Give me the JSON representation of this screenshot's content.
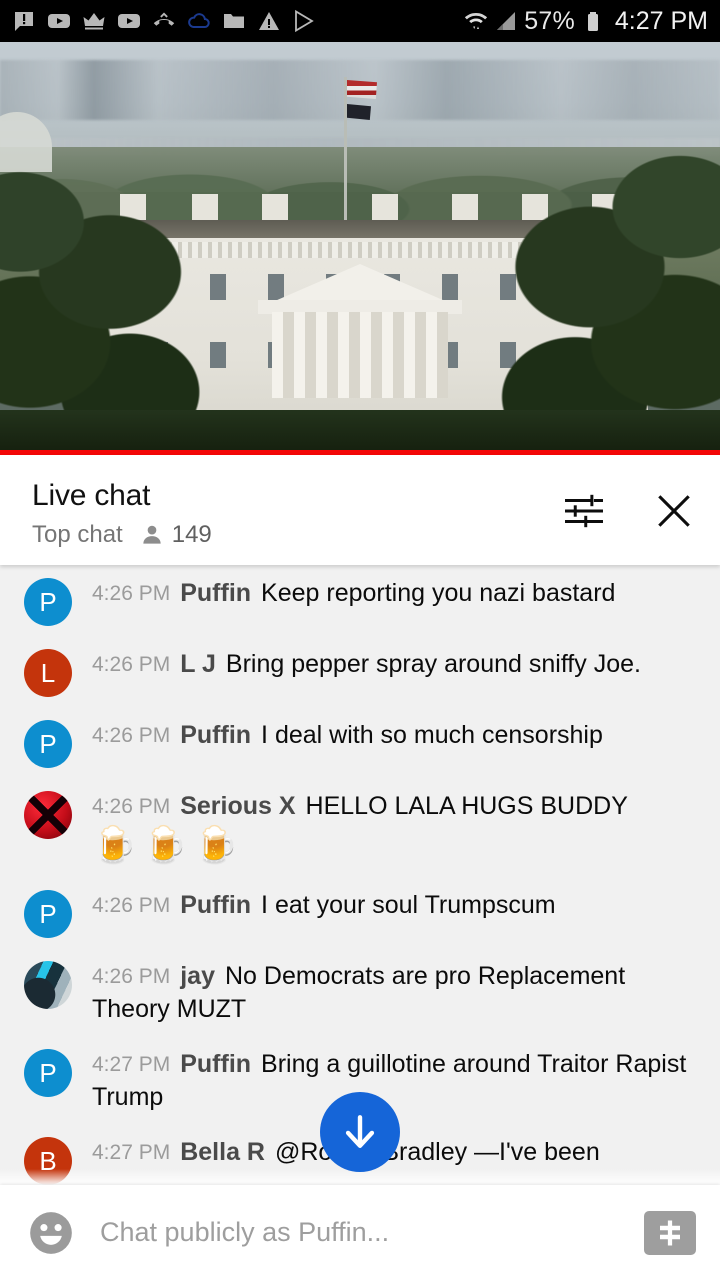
{
  "statusbar": {
    "icons": [
      "chat-alert-icon",
      "youtube-icon",
      "crown-icon",
      "youtube-icon",
      "missed-call-icon",
      "cloud-icon",
      "folder-icon",
      "warning-icon",
      "play-store-icon"
    ],
    "wifi_icon": "wifi-transfer-icon",
    "signal_icon": "cell-signal-icon",
    "battery_percent": "57%",
    "battery_icon": "battery-icon",
    "time": "4:27 PM"
  },
  "video": {
    "description": "White House live stream",
    "progress_percent": 100,
    "progress_color": "#f40707"
  },
  "chat_header": {
    "title": "Live chat",
    "subtitle": "Top chat",
    "viewer_icon": "person-icon",
    "viewer_count": "149",
    "settings_icon": "tune-icon",
    "close_icon": "close-icon"
  },
  "messages": [
    {
      "avatar_type": "letter",
      "avatar_letter": "P",
      "avatar_color": "#0d8ecf",
      "time": "4:26 PM",
      "author": "Puffin",
      "text": "Keep reporting you nazi bastard",
      "emoji": ""
    },
    {
      "avatar_type": "letter",
      "avatar_letter": "L",
      "avatar_color": "#c4340c",
      "time": "4:26 PM",
      "author": "L J",
      "text": "Bring pepper spray around sniffy Joe.",
      "emoji": ""
    },
    {
      "avatar_type": "letter",
      "avatar_letter": "P",
      "avatar_color": "#0d8ecf",
      "time": "4:26 PM",
      "author": "Puffin",
      "text": "I deal with so much censorship",
      "emoji": ""
    },
    {
      "avatar_type": "xbox",
      "avatar_letter": "",
      "avatar_color": "#c40d19",
      "time": "4:26 PM",
      "author": "Serious X",
      "text": "HELLO LALA HUGS BUDDY",
      "emoji": "🍺🍺🍺"
    },
    {
      "avatar_type": "letter",
      "avatar_letter": "P",
      "avatar_color": "#0d8ecf",
      "time": "4:26 PM",
      "author": "Puffin",
      "text": "I eat your soul Trumpscum",
      "emoji": ""
    },
    {
      "avatar_type": "photo",
      "avatar_letter": "",
      "avatar_color": "#2a4a5a",
      "time": "4:26 PM",
      "author": "jay",
      "text": "No Democrats are pro Replacement Theory MUZT",
      "emoji": ""
    },
    {
      "avatar_type": "letter",
      "avatar_letter": "P",
      "avatar_color": "#0d8ecf",
      "time": "4:27 PM",
      "author": "Puffin",
      "text": "Bring a guillotine around Traitor Rapist Trump",
      "emoji": ""
    },
    {
      "avatar_type": "letter",
      "avatar_letter": "B",
      "avatar_color": "#c4340c",
      "time": "4:27 PM",
      "author": "Bella R",
      "text": "@Robert Bradley —I've been",
      "emoji": ""
    }
  ],
  "scroll_button": {
    "icon": "arrow-down-icon",
    "color": "#1565d8"
  },
  "input_bar": {
    "emoji_icon": "emoji-smiley-icon",
    "placeholder": "Chat publicly as Puffin...",
    "value": "",
    "superchat_icon": "dollar-icon"
  }
}
